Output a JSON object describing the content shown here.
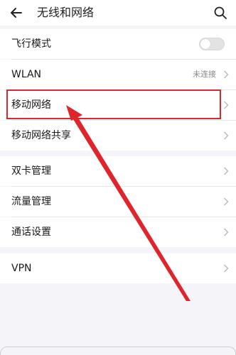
{
  "header": {
    "title": "无线和网络",
    "back_icon": "back-arrow-icon",
    "search_icon": "search-icon"
  },
  "rows": {
    "airplane": {
      "label": "飞行模式",
      "toggle_on": false
    },
    "wlan": {
      "label": "WLAN",
      "value": "未连接"
    },
    "mobile_network": {
      "label": "移动网络"
    },
    "tethering": {
      "label": "移动网络共享"
    },
    "dual_sim": {
      "label": "双卡管理"
    },
    "data_usage": {
      "label": "流量管理"
    },
    "call_settings": {
      "label": "通话设置"
    },
    "vpn": {
      "label": "VPN"
    }
  },
  "colors": {
    "annotation_red": "#e0242c",
    "chevron": "#b5b5b5",
    "background": "#f5f5f9"
  }
}
